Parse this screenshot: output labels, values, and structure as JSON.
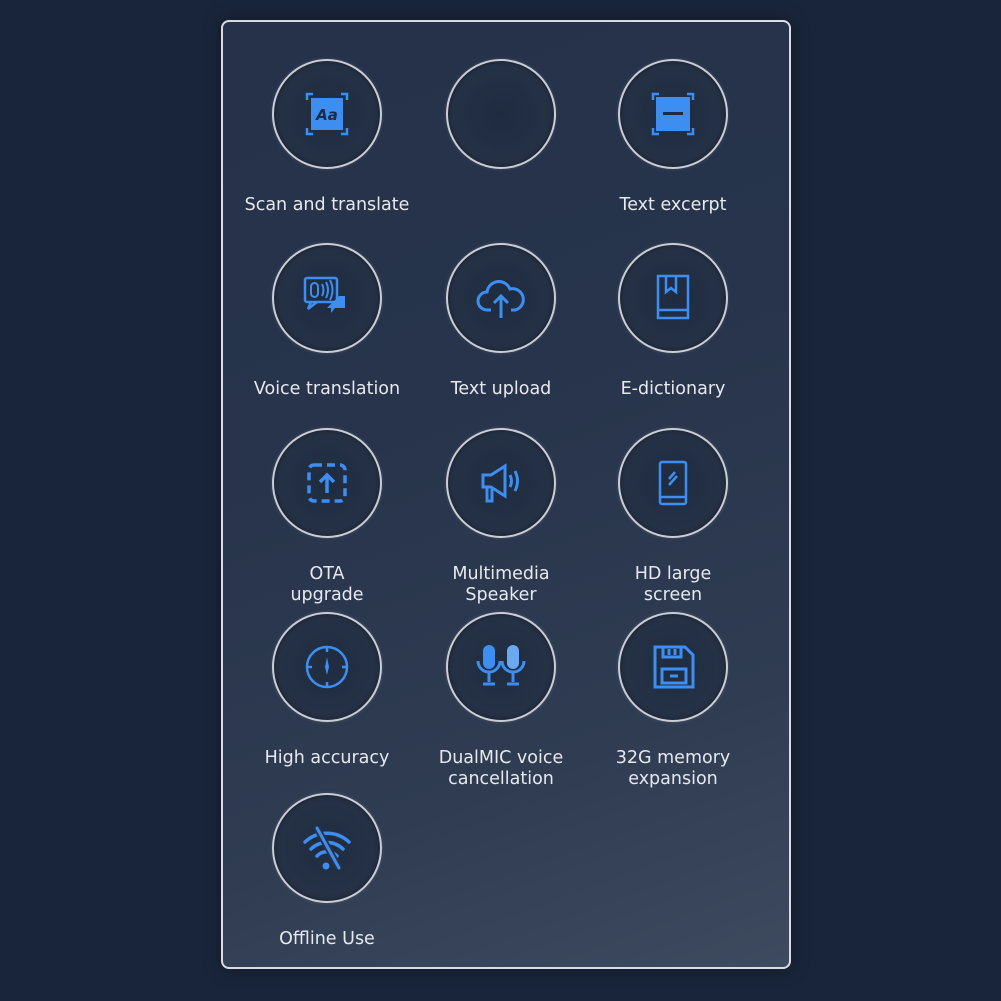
{
  "accent_color": "#3d8ef0",
  "features": [
    {
      "icon": "scan-text-icon",
      "lines": [
        "Scan and translate"
      ]
    },
    {
      "icon": "none",
      "lines": []
    },
    {
      "icon": "text-excerpt-icon",
      "lines": [
        "Text excerpt"
      ]
    },
    {
      "icon": "voice-chat-icon",
      "lines": [
        "Voice translation"
      ]
    },
    {
      "icon": "cloud-upload-icon",
      "lines": [
        "Text upload"
      ]
    },
    {
      "icon": "book-icon",
      "lines": [
        "E-dictionary"
      ]
    },
    {
      "icon": "ota-upload-icon",
      "lines": [
        "OTA",
        "upgrade"
      ]
    },
    {
      "icon": "megaphone-icon",
      "lines": [
        "Multimedia",
        "Speaker"
      ]
    },
    {
      "icon": "screen-device-icon",
      "lines": [
        "HD large",
        "screen"
      ]
    },
    {
      "icon": "target-icon",
      "lines": [
        "High accuracy"
      ]
    },
    {
      "icon": "dual-mic-icon",
      "lines": [
        "DualMIC voice",
        "cancellation"
      ]
    },
    {
      "icon": "floppy-disk-icon",
      "lines": [
        "32G memory",
        "expansion"
      ]
    },
    {
      "icon": "wifi-off-icon",
      "lines": [
        "Offline Use"
      ]
    }
  ]
}
